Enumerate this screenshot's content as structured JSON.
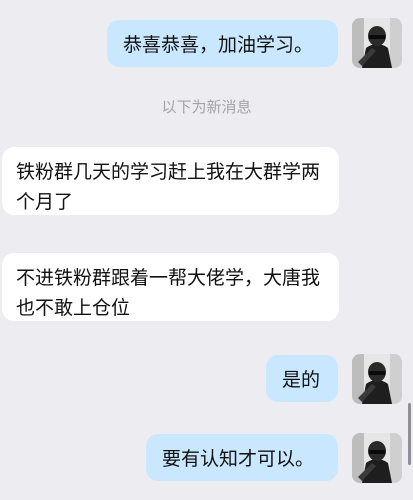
{
  "messages": [
    {
      "side": "out",
      "text": "恭喜恭喜，加油学习。"
    },
    {
      "side": "in",
      "text": "铁粉群几天的学习赶上我在大群学两个月了"
    },
    {
      "side": "in",
      "text": "不进铁粉群跟着一帮大佬学，大唐我也不敢上仓位"
    },
    {
      "side": "out",
      "text": "是的"
    },
    {
      "side": "out",
      "text": "要有认知才可以。"
    }
  ],
  "divider": {
    "text": "以下为新消息"
  },
  "colors": {
    "background": "#ececf1",
    "outgoing_bubble": "#c9e8ff",
    "incoming_bubble": "#ffffff",
    "divider_text": "#a3a3aa"
  }
}
